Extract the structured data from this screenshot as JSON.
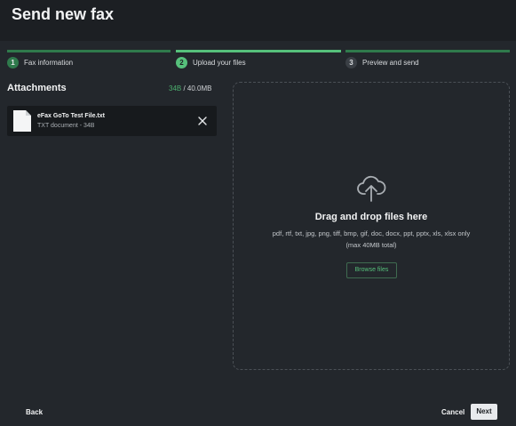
{
  "window": {
    "title": "Send new fax"
  },
  "steps": [
    {
      "number": "1",
      "label": "Fax information",
      "state": "completed"
    },
    {
      "number": "2",
      "label": "Upload your files",
      "state": "active"
    },
    {
      "number": "3",
      "label": "Preview and send",
      "state": "pending"
    }
  ],
  "attachments": {
    "title": "Attachments",
    "used_size": "34B",
    "limit_size": " / 40.0MB",
    "files": [
      {
        "name": "eFax GoTo Test File.txt",
        "meta": "TXT document - 34B",
        "icon": "document-icon"
      }
    ]
  },
  "dropzone": {
    "icon": "cloud-upload-icon",
    "title": "Drag and drop files here",
    "types": "pdf, rtf, txt, jpg, png, tiff, bmp, gif, doc, docx, ppt, pptx, xls, xlsx only (max 40MB total)",
    "browse_label": "Browse files"
  },
  "footer": {
    "back_label": "Back",
    "cancel_label": "Cancel",
    "next_label": "Next"
  },
  "colors": {
    "accent": "#4caf6e",
    "background": "#23272c",
    "header": "#1c1f23",
    "file_item": "#171a1d"
  }
}
